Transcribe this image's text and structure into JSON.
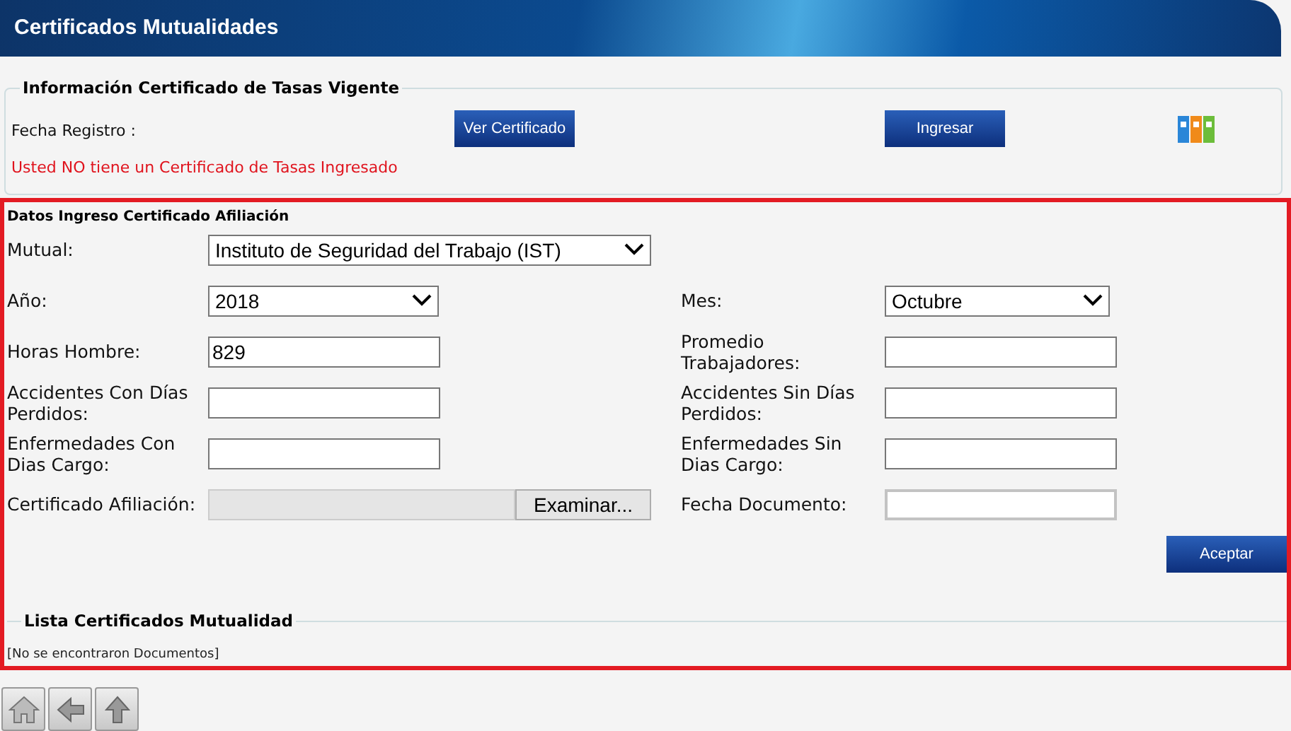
{
  "header": {
    "title": "Certificados Mutualidades"
  },
  "info": {
    "legend": "Información Certificado de Tasas Vigente",
    "date_label": "Fecha Registro :",
    "buttons": [
      "Ver Certificado",
      "Ingresar"
    ],
    "warning": "Usted NO tiene un Certificado de Tasas Ingresado"
  },
  "form": {
    "title": "Datos Ingreso Certificado Afiliación",
    "rows": [
      {
        "left": {
          "label": "Mutual:",
          "kind": "wide-select",
          "value": "Instituto de Seguridad del Trabajo (IST)"
        }
      },
      {
        "left": {
          "label": "Año:",
          "kind": "select",
          "value": "2018"
        },
        "right": {
          "label": "Mes:",
          "kind": "select",
          "value": "Octubre"
        }
      },
      {
        "left": {
          "label": "Horas Hombre:",
          "kind": "text",
          "value": "829"
        },
        "right": {
          "label": "Promedio Trabajadores:",
          "kind": "text"
        }
      },
      {
        "left": {
          "label": "Accidentes Con Días Perdidos:",
          "kind": "text"
        },
        "right": {
          "label": "Accidentes Sin Días Perdidos:",
          "kind": "text"
        }
      },
      {
        "left": {
          "label": "Enfermedades Con Dias Cargo:",
          "kind": "text"
        },
        "right": {
          "label": "Enfermedades Sin Dias Cargo:",
          "kind": "text"
        }
      },
      {
        "left": {
          "label": "Certificado Afiliación:",
          "kind": "file",
          "button": "Examinar..."
        },
        "right": {
          "label": "Fecha Documento:",
          "kind": "date"
        }
      }
    ],
    "submit": "Aceptar"
  },
  "list": {
    "legend": "Lista Certificados Mutualidad",
    "empty": "[No se encontraron Documentos]"
  }
}
